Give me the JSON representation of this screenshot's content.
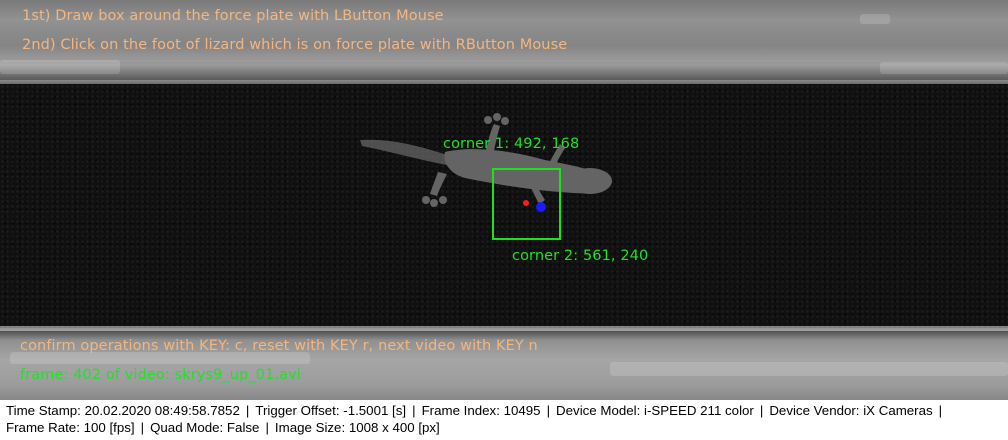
{
  "overlay": {
    "instruction_1": "1st) Draw box around the force plate with LButton Mouse",
    "instruction_2": "2nd) Click on the foot of lizard which is on force plate with RButton Mouse",
    "corner_1": "corner 1: 492, 168",
    "corner_2": "corner 2: 561, 240",
    "confirm_hint": "confirm operations with KEY: c, reset with KEY r, next video with KEY n",
    "frame_info": "frame: 402 of video: skrys9_up_01.avi",
    "colors": {
      "instruction_text": "#f3b680",
      "annotation_green": "#22e02a",
      "click_marker": "#ff1c1c",
      "foot_marker": "#1a1aff"
    }
  },
  "status_bar": {
    "line1": [
      "Time Stamp: 20.02.2020 08:49:58.7852",
      "Trigger Offset: -1.5001 [s]",
      "Frame Index: 10495",
      "Device Model: i-SPEED 211 color",
      "Device Vendor: iX Cameras"
    ],
    "line2": [
      "Frame Rate: 100 [fps]",
      "Quad Mode: False",
      "Image Size: 1008 x 400 [px]"
    ],
    "separator": "|"
  }
}
